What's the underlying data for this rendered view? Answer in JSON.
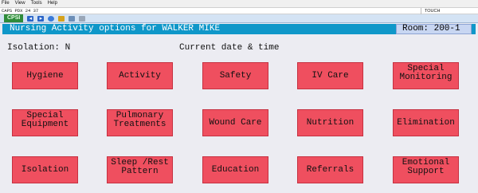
{
  "menubar": {
    "items": [
      "File",
      "View",
      "Tools",
      "Help"
    ]
  },
  "statusbar": {
    "left": "CAPS PDX 24 37",
    "right": "TOUCH"
  },
  "toolbar": {
    "app_badge": "CPSI"
  },
  "header": {
    "title": "Nursing Activity options for WALKER MIKE",
    "room": "Room: 200-1"
  },
  "info": {
    "isolation": "Isolation: N",
    "current_date": "Current date & time"
  },
  "options": [
    {
      "label": "Hygiene"
    },
    {
      "label": "Activity"
    },
    {
      "label": "Safety"
    },
    {
      "label": "IV Care"
    },
    {
      "label": "Special\nMonitoring"
    },
    {
      "label": "Special\nEquipment"
    },
    {
      "label": "Pulmonary\nTreatments"
    },
    {
      "label": "Wound Care"
    },
    {
      "label": "Nutrition"
    },
    {
      "label": "Elimination"
    },
    {
      "label": "Isolation"
    },
    {
      "label": "Sleep /Rest\nPattern"
    },
    {
      "label": "Education"
    },
    {
      "label": "Referrals"
    },
    {
      "label": "Emotional\nSupport"
    }
  ],
  "colors": {
    "title_bar": "#0f97c9",
    "room_box": "#c8d6f2",
    "option_button": "#ef4f5f",
    "background": "#ececf2"
  }
}
